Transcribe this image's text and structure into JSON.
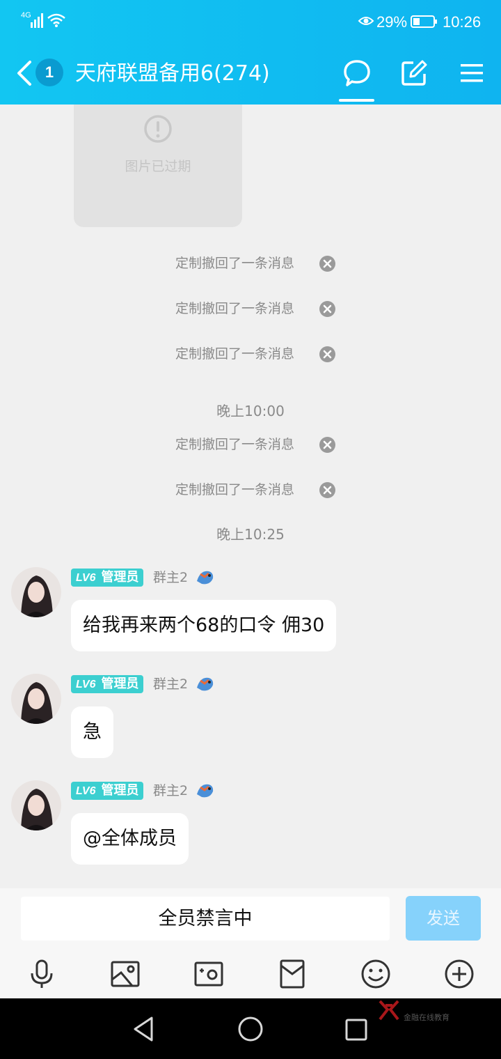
{
  "status_bar": {
    "network": "4G",
    "battery": "29%",
    "time": "10:26"
  },
  "header": {
    "unread_count": "1",
    "title": "天府联盟备用6(274)"
  },
  "expired_image": {
    "label": "图片已过期"
  },
  "recall_text": "定制撤回了一条消息",
  "timestamps": [
    "晚上10:00",
    "晚上10:25"
  ],
  "sender": {
    "level": "LV6",
    "role": "管理员",
    "nickname": "群主2"
  },
  "messages": [
    "给我再来两个68的口令   佣30",
    "急",
    "@全体成员"
  ],
  "input": {
    "muted_text": "全员禁言中",
    "send_label": "发送"
  },
  "toolbar": [
    "microphone-icon",
    "image-icon",
    "video-icon",
    "red-packet-icon",
    "emoji-icon",
    "plus-icon"
  ],
  "watermark": "金融在线教育",
  "colors": {
    "header": "#12c6f2",
    "badge": "#3ccfd0",
    "send": "#86d2fb"
  }
}
